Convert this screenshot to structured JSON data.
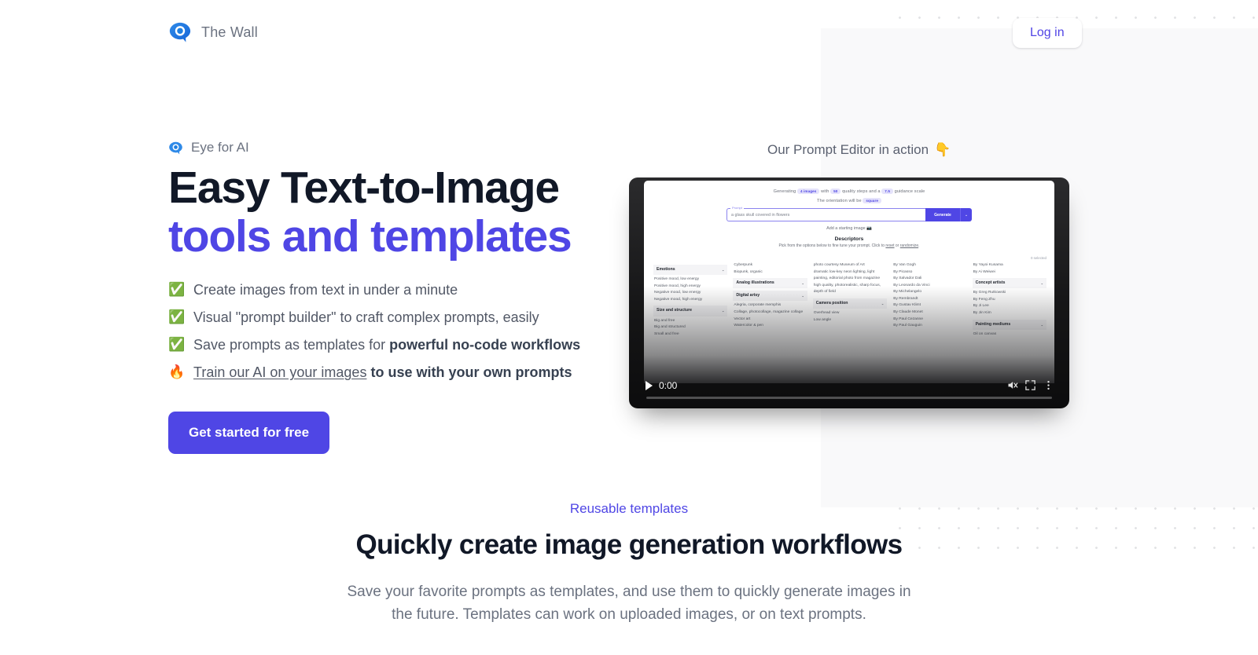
{
  "header": {
    "brand_name": "The Wall",
    "logo_icon": "eye-logo-icon",
    "login_label": "Log in"
  },
  "hero": {
    "eyebrow": "Eye for AI",
    "eyebrow_icon": "eye-icon",
    "title_line1": "Easy Text-to-Image",
    "title_line2": "tools and templates",
    "accent_color": "#4f46e5",
    "features": [
      {
        "emoji": "✅",
        "text": "Create images from text in under a minute"
      },
      {
        "emoji": "✅",
        "text": "Visual \"prompt builder\" to craft complex prompts, easily"
      },
      {
        "emoji": "✅",
        "text_before": "Save prompts as templates for ",
        "bold": "powerful no-code workflows"
      },
      {
        "emoji": "🔥",
        "link": "Train our AI on your images",
        "bold": " to use with your own prompts"
      }
    ],
    "cta_label": "Get started for free"
  },
  "video": {
    "caption": "Our Prompt Editor in action",
    "caption_emoji": "👇",
    "time": "0:00",
    "play_icon": "play-icon",
    "mute_icon": "mute-icon",
    "fullscreen_icon": "fullscreen-icon",
    "menu_icon": "kebab-menu-icon",
    "app": {
      "gen_prefix": "Generating",
      "gen_images_pill": "4 images",
      "gen_mid": "with",
      "gen_steps_pill": "50",
      "gen_mid2": "quality steps and a",
      "gen_scale_pill": "7.5",
      "gen_suffix": "guidance scale",
      "orientation_prefix": "The orientation will be",
      "orientation_pill": "square",
      "prompt_legend": "Prompt",
      "prompt_value": "a glass skull covered in flowers",
      "generate_label": "Generate",
      "caret": "⌄",
      "add_image": "Add a starting image",
      "camera_icon": "camera-icon",
      "descriptors_title": "Descriptors",
      "descriptors_sub_a": "Pick from the options below to fine tune your prompt. Click to ",
      "descriptors_sub_reset": "reset",
      "descriptors_sub_or": " or ",
      "descriptors_sub_random": "randomize",
      "descriptors_sub_end": ".",
      "selected_count": "0 selected",
      "columns": [
        {
          "items": [
            {
              "type": "group",
              "label": "Emotions"
            },
            {
              "type": "opt",
              "label": "Positive mood, low energy"
            },
            {
              "type": "opt",
              "label": "Positive mood, high energy"
            },
            {
              "type": "opt",
              "label": "Negative mood, low energy"
            },
            {
              "type": "opt",
              "label": "Negative mood, high energy"
            },
            {
              "type": "group",
              "label": "Size and structure"
            },
            {
              "type": "opt",
              "label": "Big and free"
            },
            {
              "type": "opt",
              "label": "Big and structured"
            },
            {
              "type": "opt",
              "label": "Small and free"
            }
          ]
        },
        {
          "items": [
            {
              "type": "opt",
              "label": "Cyberpunk"
            },
            {
              "type": "opt",
              "label": "Biopunk, organic"
            },
            {
              "type": "group",
              "label": "Analog illustrations"
            },
            {
              "type": "group",
              "label": "Digital artsy"
            },
            {
              "type": "opt",
              "label": "Alegria, corporate memphis"
            },
            {
              "type": "opt",
              "label": "Collage, photocollage, magazine collage"
            },
            {
              "type": "opt",
              "label": "Vector art"
            },
            {
              "type": "opt",
              "label": "Watercolor & pen"
            }
          ]
        },
        {
          "items": [
            {
              "type": "opt",
              "label": "photo courtesy Museum of Art"
            },
            {
              "type": "opt",
              "label": "dramatic low-key neon lighting, light painting, editorial photo from magazine"
            },
            {
              "type": "opt",
              "label": "high quality, photorealistic, sharp focus, depth of field"
            },
            {
              "type": "group",
              "label": "Camera position"
            },
            {
              "type": "opt",
              "label": "Overhead view"
            },
            {
              "type": "opt",
              "label": "Low angle"
            }
          ]
        },
        {
          "items": [
            {
              "type": "opt",
              "label": "By Van Gogh"
            },
            {
              "type": "opt",
              "label": "By Picasso"
            },
            {
              "type": "opt",
              "label": "By Salvador Dali"
            },
            {
              "type": "opt",
              "label": "By Leonardo da Vinci"
            },
            {
              "type": "opt",
              "label": "By Michelangelo"
            },
            {
              "type": "opt",
              "label": "By Rembrandt"
            },
            {
              "type": "opt",
              "label": "By Gustav Klimt"
            },
            {
              "type": "opt",
              "label": "By Claude Monet"
            },
            {
              "type": "opt",
              "label": "By Paul Cezanne"
            },
            {
              "type": "opt",
              "label": "By Paul Gauguin"
            }
          ]
        },
        {
          "items": [
            {
              "type": "opt",
              "label": "By Yayoi Kusama"
            },
            {
              "type": "opt",
              "label": "By Ai Weiwei"
            },
            {
              "type": "group",
              "label": "Concept artists"
            },
            {
              "type": "opt",
              "label": "By Greg Rutkowski"
            },
            {
              "type": "opt",
              "label": "By Feng Zhu"
            },
            {
              "type": "opt",
              "label": "By Ji Lee"
            },
            {
              "type": "opt",
              "label": "By Jin Kim"
            },
            {
              "type": "group",
              "label": "Painting mediums"
            },
            {
              "type": "opt",
              "label": "Oil on canvas"
            }
          ]
        }
      ]
    }
  },
  "section2": {
    "eyebrow": "Reusable templates",
    "title": "Quickly create image generation workflows",
    "body": "Save your favorite prompts as templates, and use them to quickly generate images in the future. Templates can work on uploaded images, or on text prompts."
  }
}
